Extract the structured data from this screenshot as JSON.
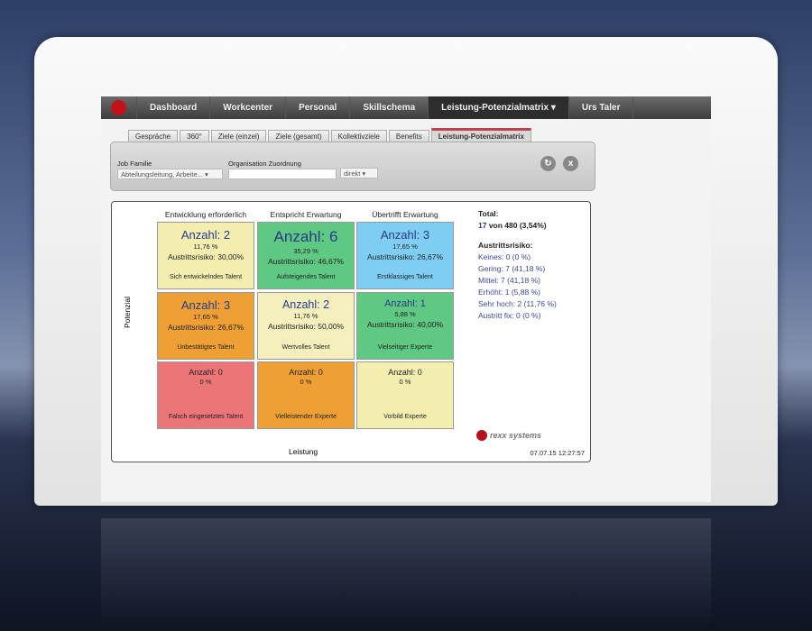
{
  "nav": {
    "items": [
      "Dashboard",
      "Workcenter",
      "Personal",
      "Skillschema",
      "Leistung-Potenzialmatrix ▾",
      "Urs Taler"
    ],
    "active": 4
  },
  "tabs": {
    "items": [
      "Gespräche",
      "360°",
      "Ziele (einzel)",
      "Ziele (gesamt)",
      "Kollektivziele",
      "Benefits",
      "Leistung-Potenzialmatrix"
    ],
    "active": 6
  },
  "filter": {
    "job_label": "Job Familie",
    "job_value": "Abteilungsleitung, Arbeite... ▾",
    "org_label": "Organisation Zuordnung",
    "org_value": "",
    "mode_value": "direkt ▾"
  },
  "matrix": {
    "columns": [
      "Entwicklung erforderlich",
      "Entspricht Erwartung",
      "Übertrifft Erwartung"
    ],
    "y_label": "Potenzial",
    "x_label": "Leistung",
    "cells": [
      {
        "count": "Anzahl: 2",
        "pct": "11,76 %",
        "risk": "Austrittsrisiko: 30,00%",
        "name": "Sich entwickelndes Talent",
        "color": "#f3eeb0"
      },
      {
        "count": "Anzahl: 6",
        "pct": "35,29 %",
        "risk": "Austrittsrisiko: 46,67%",
        "name": "Aufsteigendes Talent",
        "color": "#5fc882"
      },
      {
        "count": "Anzahl: 3",
        "pct": "17,65 %",
        "risk": "Austrittsrisiko: 26,67%",
        "name": "Erstklassiges Talent",
        "color": "#7fcdf2"
      },
      {
        "count": "Anzahl: 3",
        "pct": "17,65 %",
        "risk": "Austrittsrisiko: 26,67%",
        "name": "Unbestätigtes Talent",
        "color": "#eea035"
      },
      {
        "count": "Anzahl: 2",
        "pct": "11,76 %",
        "risk": "Austrittsrisiko: 50,00%",
        "name": "Wertvolles Talent",
        "color": "#f5efbe"
      },
      {
        "count": "Anzahl: 1",
        "pct": "5,88 %",
        "risk": "Austrittsrisiko: 40,00%",
        "name": "Vielseitiger Experte",
        "color": "#5fc882"
      },
      {
        "count": "Anzahl: 0",
        "pct": "0 %",
        "risk": "",
        "name": "Falsch eingesetztes Talent",
        "color": "#ec7578"
      },
      {
        "count": "Anzahl: 0",
        "pct": "0 %",
        "risk": "",
        "name": "Vielleistender Experte",
        "color": "#eea035"
      },
      {
        "count": "Anzahl: 0",
        "pct": "0 %",
        "risk": "",
        "name": "Vorbild Experte",
        "color": "#f3eeb0"
      }
    ]
  },
  "summary": {
    "total_label": "Total:",
    "total_value": "17",
    "total_rest": " von 480 (3,54%)",
    "risk_label": "Austrittsrisiko:",
    "risk_items": [
      "Keines: 0 (0 %)",
      "Gering: 7 (41,18 %)",
      "Mittel: 7 (41,18 %)",
      "Erhöht: 1 (5,88 %)",
      "Sehr hoch: 2 (11,76 %)",
      "Austritt fix: 0 (0 %)"
    ]
  },
  "brand": "rexx systems",
  "timestamp": "07.07.15 12:27:57"
}
